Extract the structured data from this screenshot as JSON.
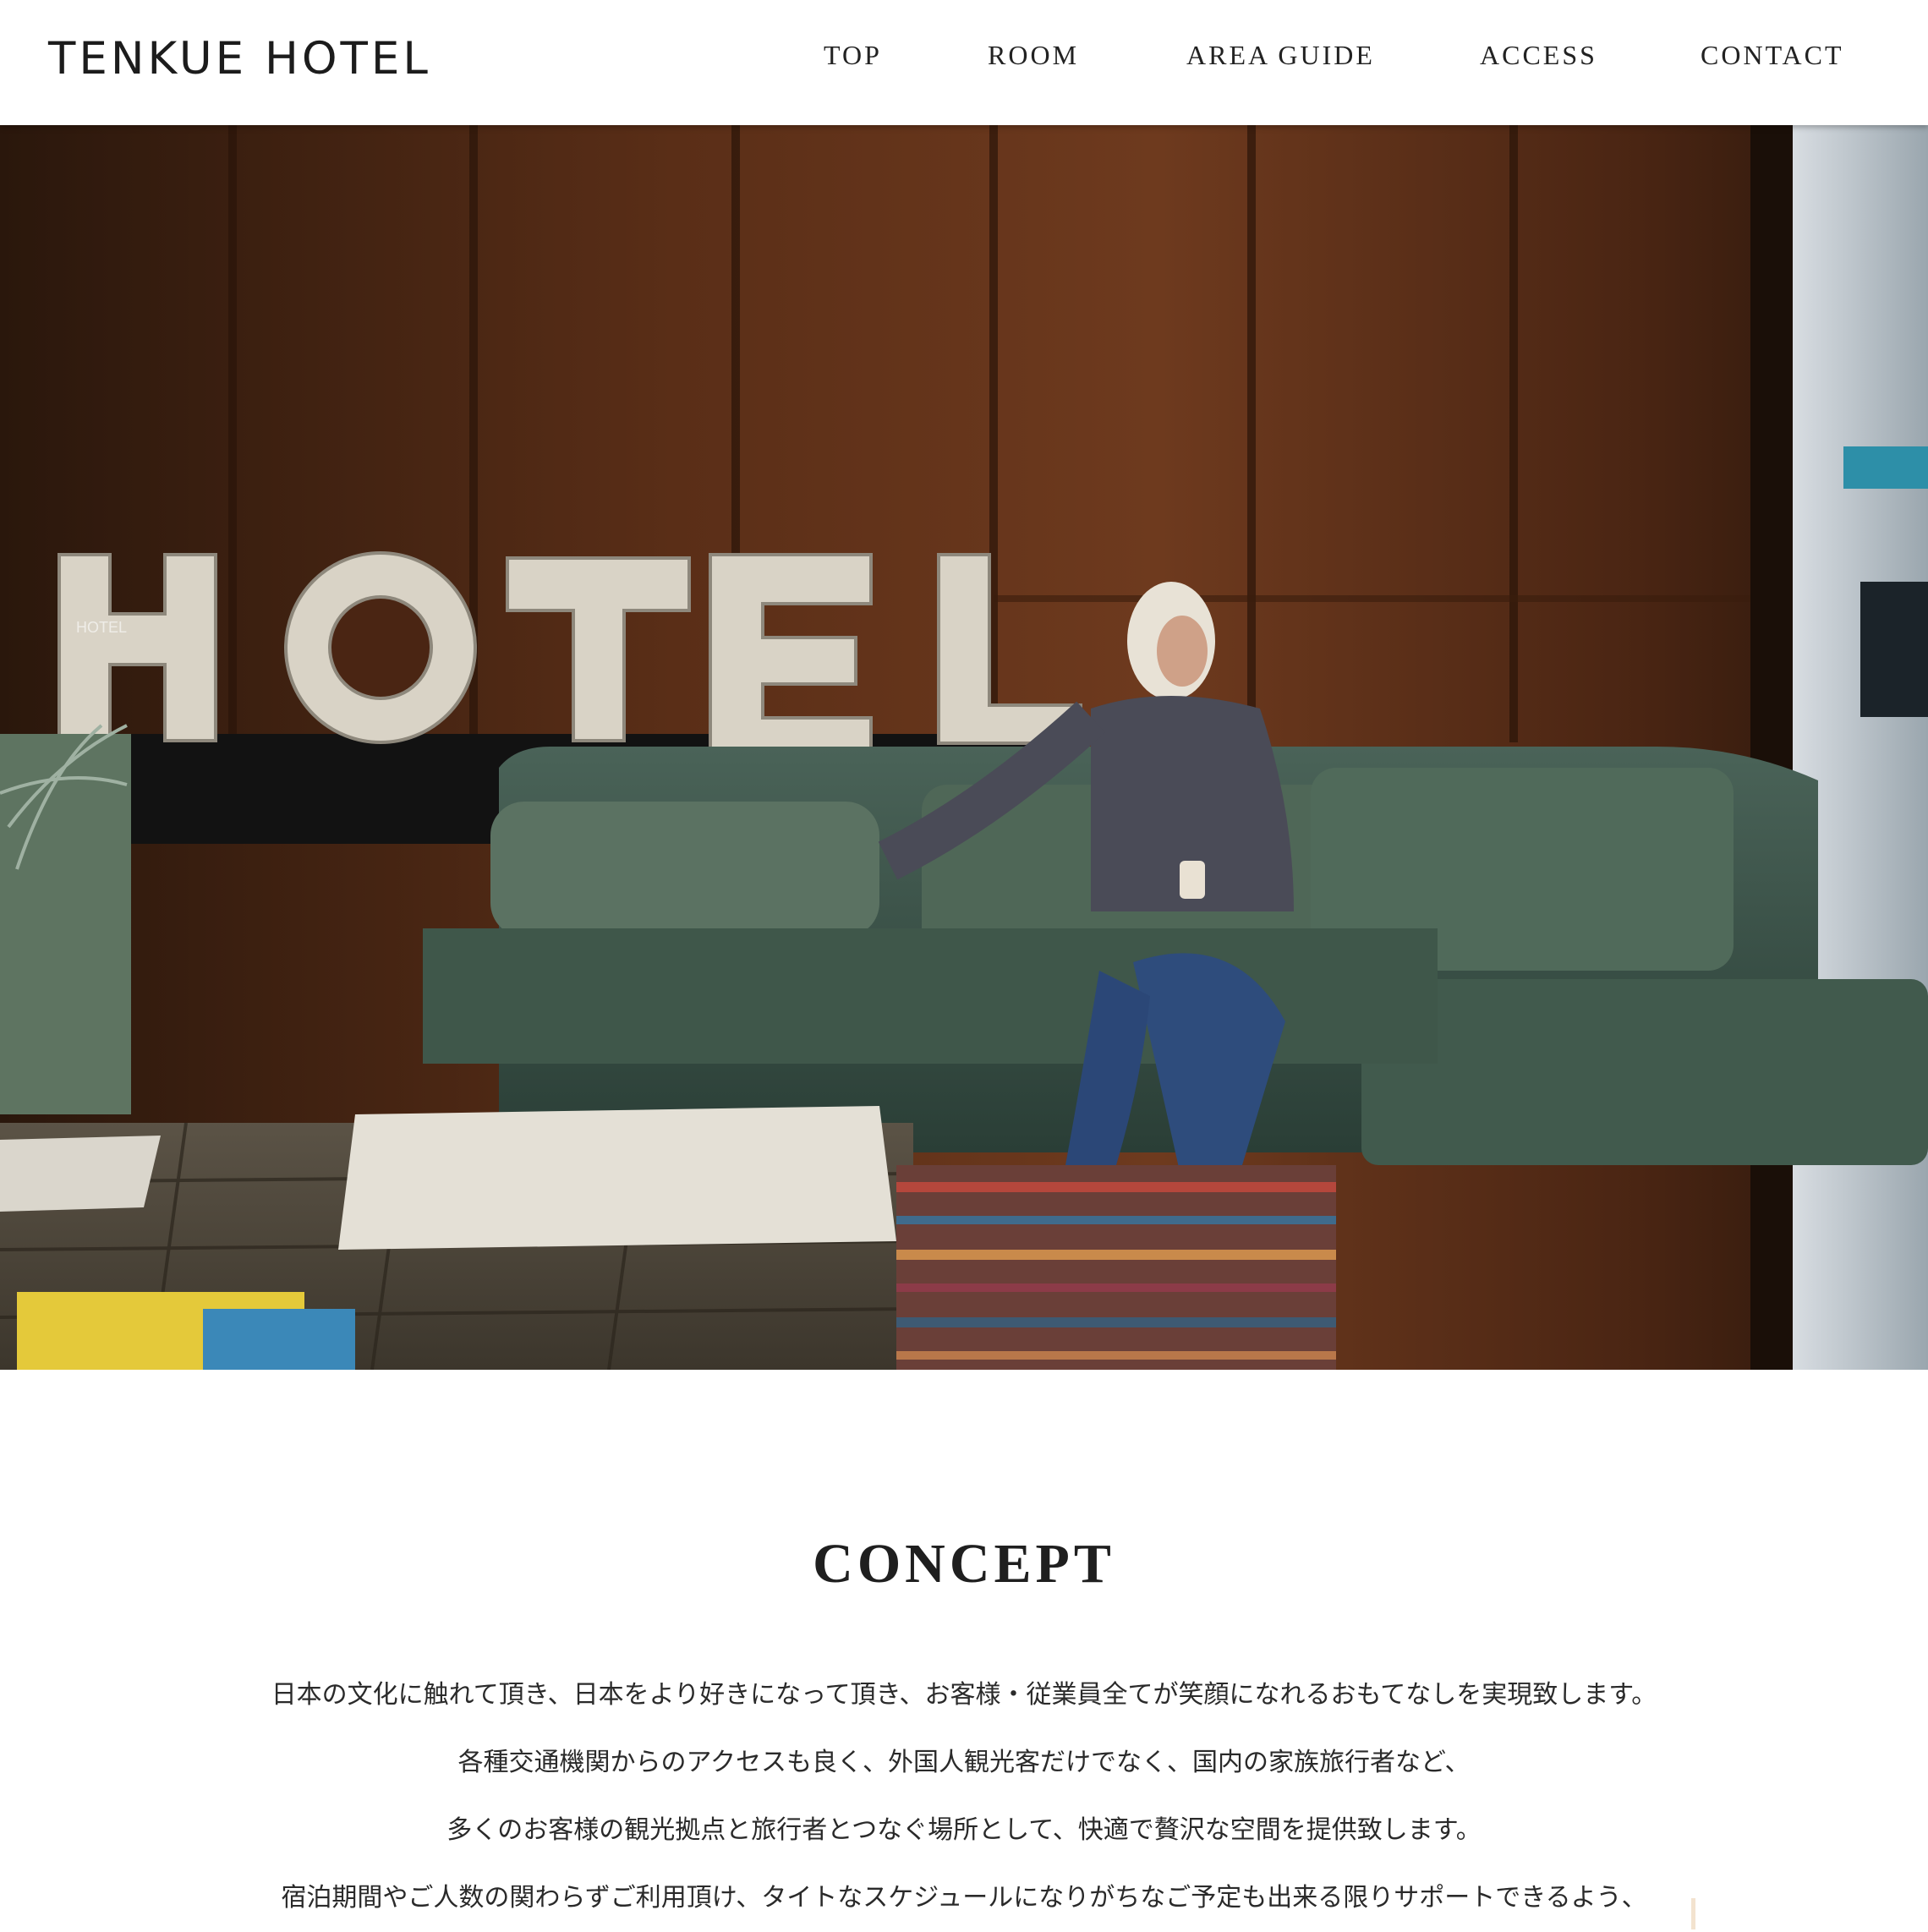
{
  "brand": {
    "name": "TENKUE HOTEL"
  },
  "nav": {
    "items": [
      {
        "label": "TOP"
      },
      {
        "label": "ROOM"
      },
      {
        "label": "AREA GUIDE"
      },
      {
        "label": "ACCESS"
      },
      {
        "label": "CONTACT"
      }
    ]
  },
  "hero": {
    "sign_text": "HOTEL"
  },
  "concept": {
    "title": "CONCEPT",
    "lines": [
      "日本の文化に触れて頂き、日本をより好きになって頂き、お客様・従業員全てが笑顔になれるおもてなしを実現致します。",
      "各種交通機関からのアクセスも良く、外国人観光客だけでなく、国内の家族旅行者など、",
      "多くのお客様の観光拠点と旅行者とつなぐ場所として、快適で贅沢な空間を提供致します。",
      "宿泊期間やご人数の関わらずご利用頂け、タイトなスケジュールになりがちなご予定も出来る限りサポートできるよう、"
    ]
  }
}
